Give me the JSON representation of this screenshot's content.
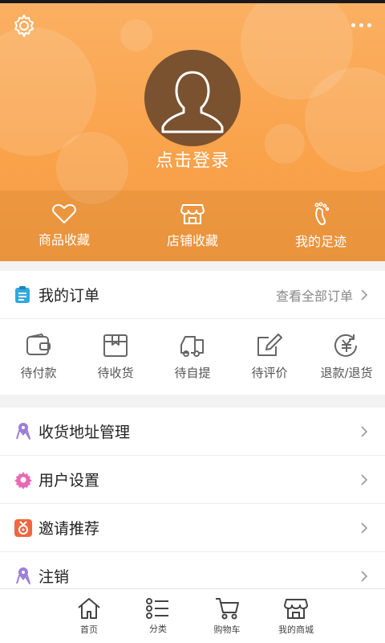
{
  "profile": {
    "login_label": "点击登录"
  },
  "favorites": [
    {
      "label": "商品收藏",
      "icon": "heart-icon"
    },
    {
      "label": "店铺收藏",
      "icon": "store-icon"
    },
    {
      "label": "我的足迹",
      "icon": "footprint-icon"
    }
  ],
  "orders": {
    "title": "我的订单",
    "view_all": "查看全部订单",
    "items": [
      {
        "label": "待付款",
        "icon": "wallet-icon"
      },
      {
        "label": "待收货",
        "icon": "package-icon"
      },
      {
        "label": "待自提",
        "icon": "truck-icon"
      },
      {
        "label": "待评价",
        "icon": "edit-icon"
      },
      {
        "label": "退款/退货",
        "icon": "refund-icon"
      }
    ]
  },
  "menu": [
    {
      "label": "收货地址管理",
      "icon": "map-pin-icon"
    },
    {
      "label": "用户设置",
      "icon": "gear-icon"
    },
    {
      "label": "邀请推荐",
      "icon": "invite-icon"
    },
    {
      "label": "注销",
      "icon": "map-pin-icon"
    }
  ],
  "tabbar": [
    {
      "label": "首页",
      "icon": "home-icon"
    },
    {
      "label": "分类",
      "icon": "list-icon"
    },
    {
      "label": "购物车",
      "icon": "cart-icon"
    },
    {
      "label": "我的商城",
      "icon": "store-icon"
    }
  ],
  "colors": {
    "header_orange": "#f9a24a",
    "avatar_brown": "#7a5230",
    "order_icon_blue": "#2fa8e0",
    "address_icon_purple": "#9b7fd8",
    "settings_icon_pink": "#e66ab3",
    "invite_icon_orange": "#f0663e"
  }
}
